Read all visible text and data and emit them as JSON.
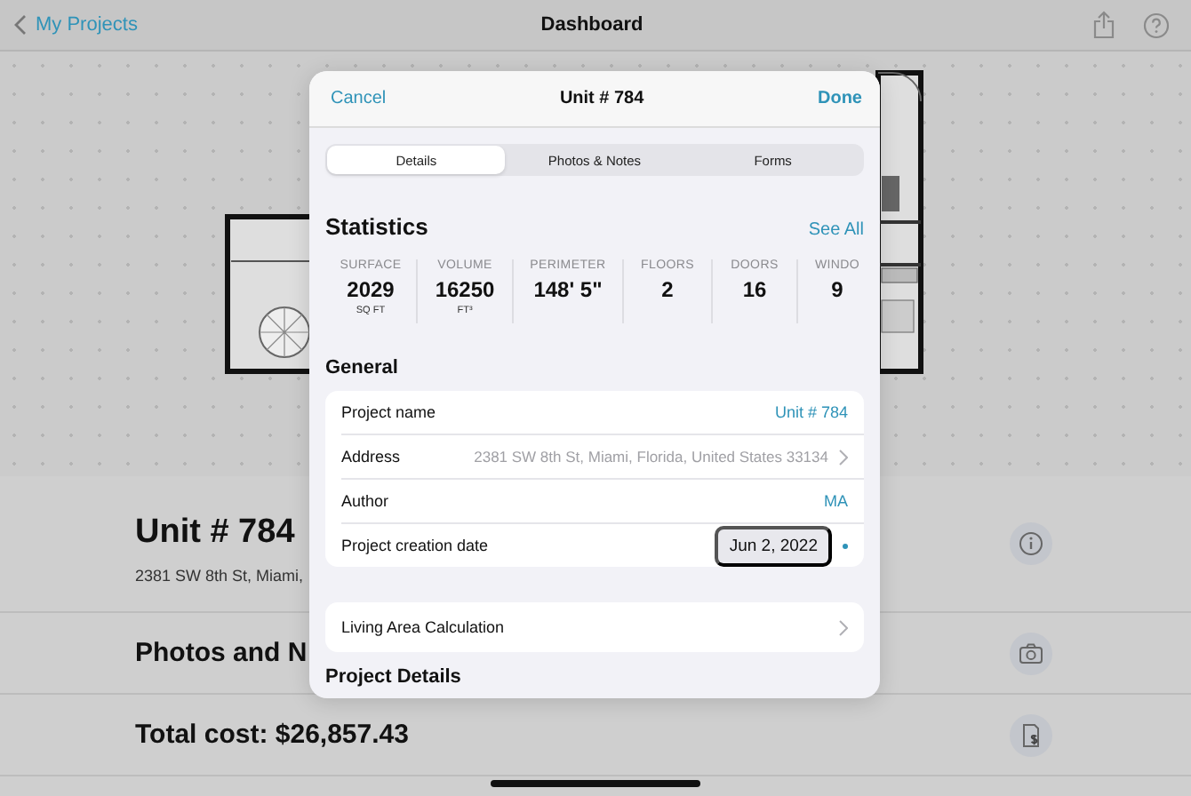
{
  "nav": {
    "back_label": "My Projects",
    "title": "Dashboard"
  },
  "summary": [
    {
      "kind": "title",
      "text": "Unit # 784",
      "subtitle": "2381 SW 8th St, Miami,"
    },
    {
      "kind": "section",
      "text": "Photos and N"
    },
    {
      "kind": "section",
      "text": "Total cost: $26,857.43"
    }
  ],
  "sheet": {
    "cancel": "Cancel",
    "title": "Unit # 784",
    "done": "Done",
    "tabs": [
      {
        "label": "Details",
        "selected": true
      },
      {
        "label": "Photos & Notes",
        "selected": false
      },
      {
        "label": "Forms",
        "selected": false
      }
    ],
    "statistics": {
      "title": "Statistics",
      "see_all": "See All",
      "items": [
        {
          "label": "SURFACE",
          "value": "2029",
          "unit": "SQ FT"
        },
        {
          "label": "VOLUME",
          "value": "16250",
          "unit": "FT³"
        },
        {
          "label": "PERIMETER",
          "value": "148' 5\""
        },
        {
          "label": "FLOORS",
          "value": "2"
        },
        {
          "label": "DOORS",
          "value": "16"
        },
        {
          "label": "WINDO",
          "value": "9"
        }
      ]
    },
    "general": {
      "title": "General",
      "rows": [
        {
          "kind": "link",
          "label": "Project name",
          "value": "Unit # 784"
        },
        {
          "kind": "disclosure",
          "label": "Address",
          "value": "2381 SW 8th St, Miami, Florida, United States 33134"
        },
        {
          "kind": "link",
          "label": "Author",
          "value": "MA"
        },
        {
          "kind": "date",
          "label": "Project creation date",
          "value": "Jun 2, 2022"
        }
      ]
    },
    "living_area": {
      "label": "Living Area Calculation"
    },
    "next_section": "Project Details"
  }
}
